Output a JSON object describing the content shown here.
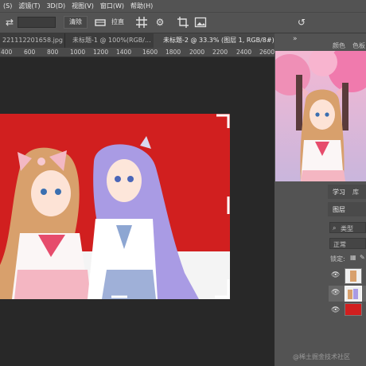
{
  "menu": [
    "(S)",
    "滤镜(T)",
    "3D(D)",
    "视图(V)",
    "窗口(W)",
    "帮助(H)"
  ],
  "toolbar": {
    "clear_label": "清除",
    "straighten_label": "拉直"
  },
  "tabs": [
    {
      "label": "221112201658.jpg",
      "active": false
    },
    {
      "label": "未标题-1 @ 100%(RGB/...",
      "active": false
    },
    {
      "label": "未标题-2 @ 33.3% (图层 1, RGB/8#) *",
      "active": true
    }
  ],
  "tab_overflow": "»",
  "ruler_ticks": [
    "400",
    "600",
    "800",
    "1000",
    "1200",
    "1400",
    "1600",
    "1800",
    "2000",
    "2200",
    "2400",
    "2600"
  ],
  "right_panel": {
    "top_tabs": [
      "颜色",
      "色板"
    ],
    "mid_tabs": [
      "学习",
      "库"
    ],
    "layers_tab": "图层",
    "search_kind": "类型",
    "blend_mode": "正常",
    "lock_label": "锁定:"
  },
  "colors": {
    "canvas_fill": "#d11f1f",
    "panel": "#535353",
    "workspace": "#282828"
  },
  "watermark": "@稀土掘金技术社区"
}
